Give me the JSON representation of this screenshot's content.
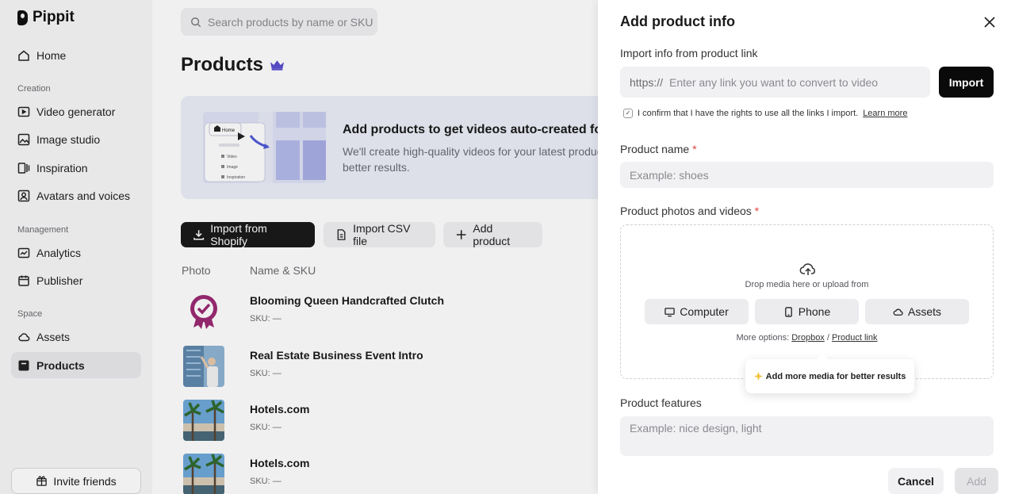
{
  "app": {
    "name": "Pippit"
  },
  "sidebar": {
    "home": "Home",
    "sections": {
      "creation": "Creation",
      "management": "Management",
      "space": "Space"
    },
    "creation_items": [
      "Video generator",
      "Image studio",
      "Inspiration",
      "Avatars and voices"
    ],
    "management_items": [
      "Analytics",
      "Publisher"
    ],
    "space_items": [
      "Assets",
      "Products"
    ],
    "active_item": "Products",
    "invite_label": "Invite friends"
  },
  "search": {
    "placeholder": "Search products by name or SKU"
  },
  "page": {
    "title": "Products"
  },
  "banner": {
    "title": "Add products to get videos auto-created for yo",
    "desc_line1": "We'll create high-quality videos for your latest product in",
    "desc_line2": "better results.",
    "art": {
      "home": "Home",
      "items": [
        "Video",
        "Image",
        "Inspiration"
      ]
    }
  },
  "actions": {
    "shopify": "Import from Shopify",
    "csv": "Import CSV file",
    "add": "Add product"
  },
  "table": {
    "headers": {
      "photo": "Photo",
      "name": "Name & SKU"
    },
    "rows": [
      {
        "name": "Blooming Queen Handcrafted Clutch",
        "sku": "SKU: —"
      },
      {
        "name": "Real Estate Business Event Intro",
        "sku": "SKU: —"
      },
      {
        "name": "Hotels.com",
        "sku": "SKU: —"
      },
      {
        "name": "Hotels.com",
        "sku": "SKU: —"
      }
    ]
  },
  "drawer": {
    "title": "Add product info",
    "import_label": "Import info from product link",
    "link_prefix": "https://",
    "link_placeholder": "Enter any link you want to convert to video",
    "import_button": "Import",
    "confirm_text": "I confirm that I have the rights to use all the links I import.",
    "learn_more": "Learn more",
    "confirm_checked": true,
    "product_name_label": "Product name",
    "required_mark": "*",
    "product_name_placeholder": "Example: shoes",
    "media_label": "Product photos and videos",
    "drop_text": "Drop media here or upload from",
    "sources": [
      "Computer",
      "Phone",
      "Assets"
    ],
    "more_options": "More options:",
    "dropbox": "Dropbox",
    "separator": "/",
    "product_link": "Product link",
    "tooltip": "Add more media for better results",
    "features_label": "Product features",
    "features_placeholder": "Example: nice design, light",
    "cancel": "Cancel",
    "add": "Add"
  },
  "colors": {
    "primary": "#0a0a0a",
    "required": "#e0453a",
    "accent_purple": "#5a4fcf",
    "badge_magenta": "#9c2a73"
  }
}
